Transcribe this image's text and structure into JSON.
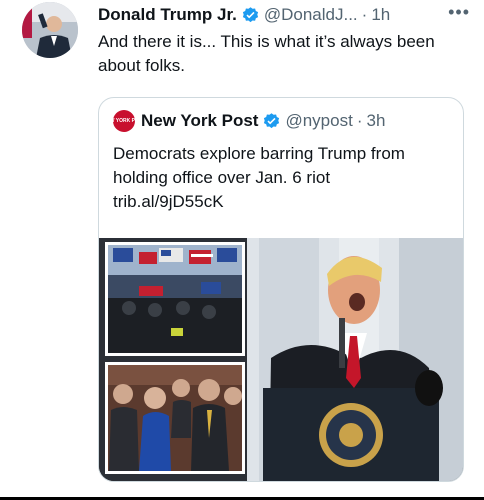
{
  "tweet": {
    "author_name": "Donald Trump Jr.",
    "handle": "@DonaldJ...",
    "separator": "·",
    "time": "1h",
    "more_icon": "more-dots-icon",
    "text": "And there it is... This is what it’s always been about folks."
  },
  "quote": {
    "logo_text": "NEW YORK POST",
    "author_name": "New York Post",
    "handle": "@nypost",
    "separator": "·",
    "time": "3h",
    "text": "Democrats explore barring Trump from holding office over Jan. 6 riot",
    "link": "trib.al/9jD55cK"
  },
  "colors": {
    "verified": "#1d9bf0",
    "secondary_text": "#536471",
    "border": "#cfd9de",
    "nypost_red": "#c8102e"
  }
}
